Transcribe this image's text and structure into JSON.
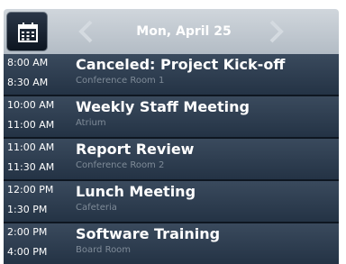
{
  "header": {
    "date": "Mon, April 25",
    "calendar_icon": "calendar-icon",
    "prev_icon": "chevron-left-icon",
    "next_icon": "chevron-right-icon"
  },
  "events": [
    {
      "start": "8:00 AM",
      "end": "8:30 AM",
      "title": "Canceled: Project Kick-off",
      "location": "Conference Room 1"
    },
    {
      "start": "10:00 AM",
      "end": "11:00 AM",
      "title": "Weekly Staff Meeting",
      "location": "Atrium"
    },
    {
      "start": "11:00 AM",
      "end": "11:30 AM",
      "title": "Report Review",
      "location": "Conference Room 2"
    },
    {
      "start": "12:00 PM",
      "end": "1:30 PM",
      "title": "Lunch Meeting",
      "location": "Cafeteria"
    },
    {
      "start": "2:00 PM",
      "end": "4:00 PM",
      "title": "Software Training",
      "location": "Board Room"
    }
  ],
  "colors": {
    "header_bg": "#c2cad2",
    "list_bg": "#2f3e51",
    "location_text": "#7f8b98",
    "arrow": "#c9d0d7"
  }
}
